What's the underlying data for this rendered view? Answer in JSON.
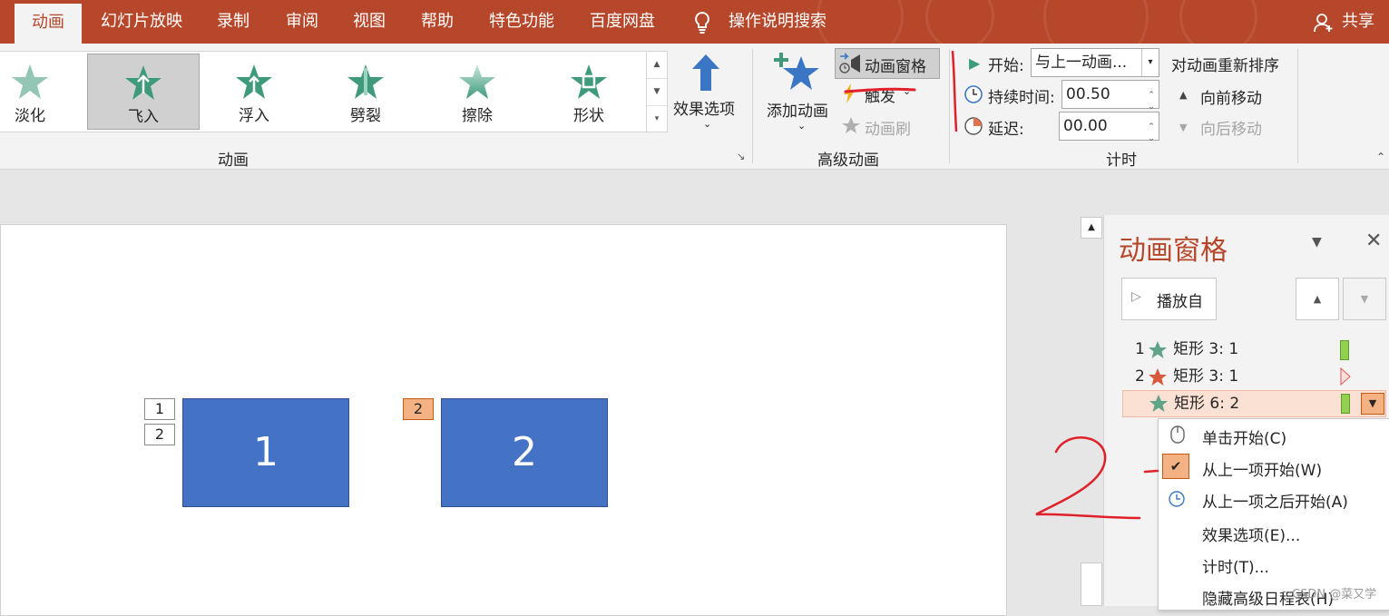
{
  "tabs": [
    {
      "label": "动画",
      "active": true
    },
    {
      "label": "幻灯片放映"
    },
    {
      "label": "录制"
    },
    {
      "label": "审阅"
    },
    {
      "label": "视图"
    },
    {
      "label": "帮助"
    },
    {
      "label": "特色功能"
    },
    {
      "label": "百度网盘"
    }
  ],
  "tell_me": "操作说明搜索",
  "share": "共享",
  "animation_gallery": {
    "items": [
      "淡化",
      "飞入",
      "浮入",
      "劈裂",
      "擦除",
      "形状"
    ],
    "selected": "飞入",
    "group_label": "动画"
  },
  "effect_options": "效果选项",
  "advanced": {
    "add_animation": "添加动画",
    "animation_pane": "动画窗格",
    "trigger": "触发",
    "painter": "动画刷",
    "group_label": "高级动画"
  },
  "timing": {
    "start_label": "开始:",
    "start_value": "与上一动画...",
    "duration_label": "持续时间:",
    "duration_value": "00.50",
    "delay_label": "延迟:",
    "delay_value": "00.00",
    "reorder_title": "对动画重新排序",
    "move_earlier": "向前移动",
    "move_later": "向后移动",
    "group_label": "计时"
  },
  "slide": {
    "tags_left": [
      "1",
      "2"
    ],
    "tag_right": "2",
    "shape1_text": "1",
    "shape2_text": "2"
  },
  "pane": {
    "title": "动画窗格",
    "play_from": "播放自",
    "items": [
      {
        "index": "1",
        "label": "矩形 3: 1",
        "star_color": "#5fa389"
      },
      {
        "index": "2",
        "label": "矩形 3: 1",
        "star_color": "#d9573b"
      },
      {
        "index": "",
        "label": "矩形 6: 2",
        "star_color": "#5fa389"
      }
    ]
  },
  "context_menu": {
    "items": [
      "单击开始(C)",
      "从上一项开始(W)",
      "从上一项之后开始(A)",
      "效果选项(E)...",
      "计时(T)...",
      "隐藏高级日程表(H)"
    ],
    "checked": "从上一项开始(W)"
  },
  "watermark": "CSDN @菜又学",
  "colors": {
    "accent": "#b7472a",
    "shape_blue": "#4472c4",
    "star_green": "#5fa389",
    "star_red": "#d9573b",
    "annotation_red": "#e0202a"
  }
}
